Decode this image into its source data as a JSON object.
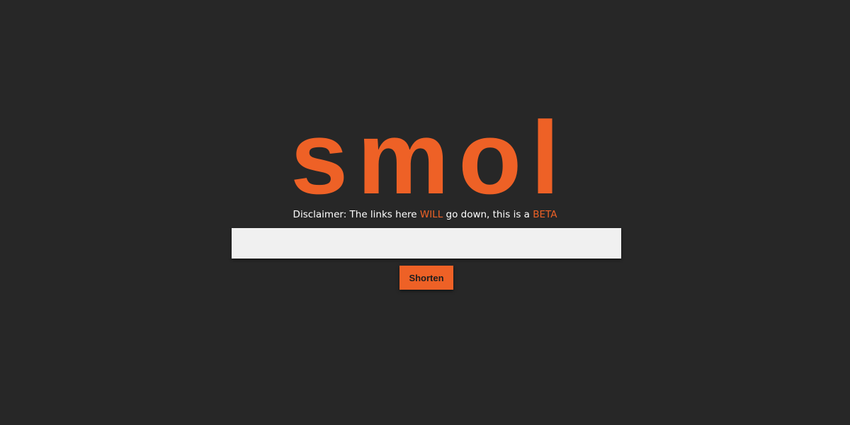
{
  "app": {
    "logo_text": "smol",
    "accent_color": "#ee6126",
    "background_color": "#272727"
  },
  "disclaimer": {
    "part1": "Disclaimer: The links here ",
    "highlight1": "WILL",
    "part2": " go down, this is a ",
    "highlight2": "BETA"
  },
  "form": {
    "url_input_value": "",
    "url_input_placeholder": "",
    "shorten_label": "Shorten"
  }
}
